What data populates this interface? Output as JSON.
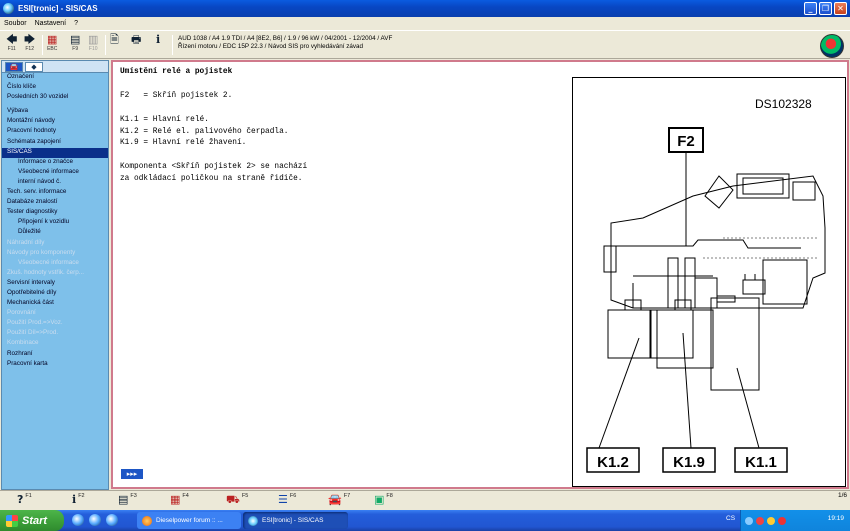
{
  "window": {
    "title": "ESI[tronic] - SIS/CAS",
    "buttons": [
      "_",
      "❐",
      "✕"
    ]
  },
  "menu": [
    "Soubor",
    "Nastavení",
    "?"
  ],
  "toolbar": {
    "buttons": [
      {
        "icon": "arrow-left-icon",
        "glyph": "🡄",
        "label": "F11"
      },
      {
        "icon": "arrow-right-icon",
        "glyph": "🡆",
        "label": "F12"
      },
      {
        "icon": "ebc-icon",
        "glyph": "▦",
        "label": "EBC"
      },
      {
        "icon": "f9-icon",
        "glyph": "▤",
        "label": "F9"
      },
      {
        "icon": "f10-icon",
        "glyph": "▥",
        "label": "F10"
      },
      {
        "icon": "document-icon",
        "glyph": "🗎",
        "label": ""
      },
      {
        "icon": "printer-icon",
        "glyph": "🖶",
        "label": ""
      },
      {
        "icon": "info-icon",
        "glyph": "i",
        "label": ""
      }
    ],
    "vehicle_line1": "AUD 1038 / A4 1.9 TDI / A4 [8E2, B6] / 1.9 / 96 kW / 04/2001 - 12/2004 / AVF",
    "vehicle_line2": "Řízení motoru / EDC 15P 22.3 / Návod SIS pro vyhledávání závad"
  },
  "sidebar": {
    "tabs": [
      {
        "icon": "car-icon",
        "glyph": "🚘"
      },
      {
        "icon": "arrow-icon",
        "glyph": "◆"
      }
    ],
    "items": [
      {
        "label": "Označení",
        "sub": false,
        "state": "normal"
      },
      {
        "label": "Číslo klíče",
        "sub": false,
        "state": "normal"
      },
      {
        "label": "Posledních 30 vozidel",
        "sub": false,
        "state": "normal"
      },
      {
        "gap": true
      },
      {
        "label": "Výbava",
        "sub": false,
        "state": "normal"
      },
      {
        "label": "Montážní návody",
        "sub": false,
        "state": "normal"
      },
      {
        "label": "Pracovní hodnoty",
        "sub": false,
        "state": "normal"
      },
      {
        "label": "Schémata zapojení",
        "sub": false,
        "state": "normal"
      },
      {
        "label": "SIS/CAS",
        "sub": false,
        "state": "selected"
      },
      {
        "label": "Informace o značce",
        "sub": true,
        "state": "normal"
      },
      {
        "label": "Všeobecné informace",
        "sub": true,
        "state": "normal"
      },
      {
        "label": "interní návod č.",
        "sub": true,
        "state": "normal"
      },
      {
        "label": "Tech. serv. informace",
        "sub": false,
        "state": "normal"
      },
      {
        "label": "Databáze znalostí",
        "sub": false,
        "state": "normal"
      },
      {
        "label": "Tester diagnostiky",
        "sub": false,
        "state": "normal"
      },
      {
        "label": "Připojení k vozidlu",
        "sub": true,
        "state": "normal"
      },
      {
        "label": "Důležité",
        "sub": true,
        "state": "normal"
      },
      {
        "label": "Náhradní díly",
        "sub": false,
        "state": "disabled"
      },
      {
        "label": "Návody pro komponenty",
        "sub": false,
        "state": "disabled"
      },
      {
        "label": "Všeobecné informace",
        "sub": true,
        "state": "disabled"
      },
      {
        "label": "Zkuš. hodnoty vstřik. čerp...",
        "sub": false,
        "state": "disabled"
      },
      {
        "label": "Servisní intervaly",
        "sub": false,
        "state": "normal"
      },
      {
        "label": "Opotřebitelné díly",
        "sub": false,
        "state": "normal"
      },
      {
        "label": "Mechanická část",
        "sub": false,
        "state": "normal"
      },
      {
        "label": "Porovnání",
        "sub": false,
        "state": "disabled"
      },
      {
        "label": "Použití Prod.=>Voz.",
        "sub": false,
        "state": "disabled"
      },
      {
        "label": "Použití Díl=>Prod.",
        "sub": false,
        "state": "disabled"
      },
      {
        "label": "Kombinace",
        "sub": false,
        "state": "disabled"
      },
      {
        "label": "Rozhraní",
        "sub": false,
        "state": "normal"
      },
      {
        "label": "Pracovní karta",
        "sub": false,
        "state": "normal"
      }
    ]
  },
  "content": {
    "heading": "Umístění relé a pojistek",
    "lines": [
      "F2   = Skříň pojistek 2.",
      "",
      "K1.1 = Hlavní relé.",
      "K1.2 = Relé el. palivového čerpadla.",
      "K1.9 = Hlavní relé žhavení.",
      "",
      "Komponenta <Skříň pojistek 2> se nachází",
      "za odkládací poličkou na straně řidiče."
    ],
    "figure": {
      "code": "DS102328",
      "labels": {
        "f2": "F2",
        "k12": "K1.2",
        "k19": "K1.9",
        "k11": "K1.1"
      }
    },
    "nav_arrow": "▸▸▸"
  },
  "fnbar": {
    "keys": [
      {
        "icon": "help-icon",
        "glyph": "?",
        "num": "F1"
      },
      {
        "icon": "info-icon",
        "glyph": "i",
        "num": "F2"
      },
      {
        "icon": "list-icon",
        "glyph": "▤",
        "num": "F3"
      },
      {
        "icon": "table-icon",
        "glyph": "▦",
        "num": "F4"
      },
      {
        "icon": "car-data-icon",
        "glyph": "⛟",
        "num": "F5"
      },
      {
        "icon": "text-icon",
        "glyph": "☰",
        "num": "F6"
      },
      {
        "icon": "car-icon",
        "glyph": "🚘",
        "num": "F7"
      },
      {
        "icon": "esi-icon",
        "glyph": "▣",
        "num": "F8"
      }
    ],
    "page": "1/6"
  },
  "taskbar": {
    "start": "Start",
    "tasks": [
      "Dieselpower forum :: ...",
      "ESI[tronic] - SIS/CAS"
    ],
    "lang": "CS",
    "clock": "19:19"
  }
}
